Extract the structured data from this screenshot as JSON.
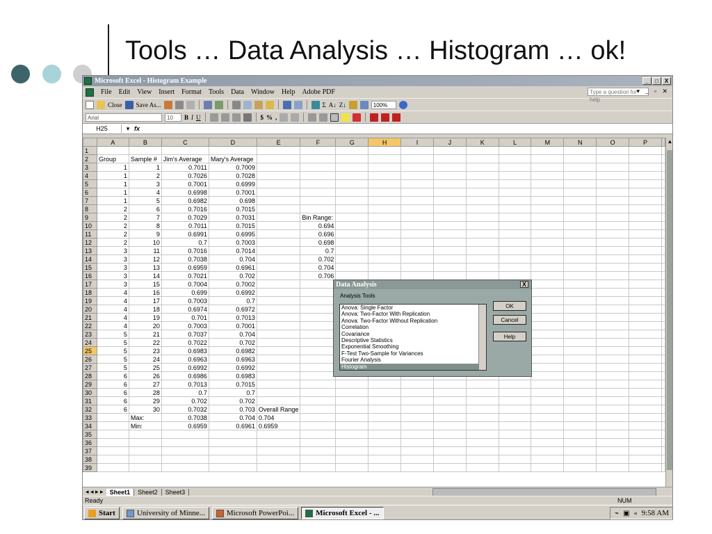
{
  "slide": {
    "title": "Tools … Data Analysis … Histogram … ok!"
  },
  "window": {
    "title": "Microsoft Excel - Histogram Example",
    "controls": [
      "_",
      "□",
      "X"
    ]
  },
  "menu": {
    "items": [
      "File",
      "Edit",
      "View",
      "Insert",
      "Format",
      "Tools",
      "Data",
      "Window",
      "Help",
      "Adobe PDF"
    ],
    "help_placeholder": "Type a question for help"
  },
  "toolbar": {
    "close_label": "Close",
    "saveas_label": "Save As...",
    "zoom": "100%",
    "font": "Arial",
    "font_size": "10",
    "bold": "B",
    "italic": "I",
    "underline": "U",
    "currency": "$",
    "percent": "%",
    "comma": ","
  },
  "formula_bar": {
    "name_box": "H25",
    "fx": "fx"
  },
  "grid": {
    "columns": [
      "A",
      "B",
      "C",
      "D",
      "E",
      "F",
      "G",
      "H",
      "I",
      "J",
      "K",
      "L",
      "M",
      "N",
      "O",
      "P"
    ],
    "selected_column": "H",
    "selected_row": 25,
    "rows": [
      [
        "",
        "",
        "",
        "",
        "",
        ""
      ],
      [
        "Group",
        "Sample #",
        "Jim's Average",
        "Mary's Average",
        "",
        ""
      ],
      [
        "1",
        "1",
        "0.7011",
        "0.7009",
        "",
        ""
      ],
      [
        "1",
        "2",
        "0.7026",
        "0.7028",
        "",
        ""
      ],
      [
        "1",
        "3",
        "0.7001",
        "0.6999",
        "",
        ""
      ],
      [
        "1",
        "4",
        "0.6998",
        "0.7001",
        "",
        ""
      ],
      [
        "1",
        "5",
        "0.6982",
        "0.698",
        "",
        ""
      ],
      [
        "2",
        "6",
        "0.7016",
        "0.7015",
        "",
        ""
      ],
      [
        "2",
        "7",
        "0.7029",
        "0.7031",
        "",
        "Bin Range:"
      ],
      [
        "2",
        "8",
        "0.7011",
        "0.7015",
        "",
        "0.694"
      ],
      [
        "2",
        "9",
        "0.6991",
        "0.6995",
        "",
        "0.696"
      ],
      [
        "2",
        "10",
        "0.7",
        "0.7003",
        "",
        "0.698"
      ],
      [
        "3",
        "11",
        "0.7016",
        "0.7014",
        "",
        "0.7"
      ],
      [
        "3",
        "12",
        "0.7038",
        "0.704",
        "",
        "0.702"
      ],
      [
        "3",
        "13",
        "0.6959",
        "0.6961",
        "",
        "0.704"
      ],
      [
        "3",
        "14",
        "0.7021",
        "0.702",
        "",
        "0.706"
      ],
      [
        "3",
        "15",
        "0.7004",
        "0.7002",
        "",
        ""
      ],
      [
        "4",
        "16",
        "0.699",
        "0.6992",
        "",
        ""
      ],
      [
        "4",
        "17",
        "0.7003",
        "0.7",
        "",
        ""
      ],
      [
        "4",
        "18",
        "0.6974",
        "0.6972",
        "",
        ""
      ],
      [
        "4",
        "19",
        "0.701",
        "0.7013",
        "",
        ""
      ],
      [
        "4",
        "20",
        "0.7003",
        "0.7001",
        "",
        ""
      ],
      [
        "5",
        "21",
        "0.7037",
        "0.704",
        "",
        ""
      ],
      [
        "5",
        "22",
        "0.7022",
        "0.702",
        "",
        ""
      ],
      [
        "5",
        "23",
        "0.6983",
        "0.6982",
        "",
        ""
      ],
      [
        "5",
        "24",
        "0.6963",
        "0.6963",
        "",
        ""
      ],
      [
        "5",
        "25",
        "0.6992",
        "0.6992",
        "",
        ""
      ],
      [
        "6",
        "26",
        "0.6986",
        "0.6983",
        "",
        ""
      ],
      [
        "6",
        "27",
        "0.7013",
        "0.7015",
        "",
        ""
      ],
      [
        "6",
        "28",
        "0.7",
        "0.7",
        "",
        ""
      ],
      [
        "6",
        "29",
        "0.702",
        "0.702",
        "",
        ""
      ],
      [
        "6",
        "30",
        "0.7032",
        "0.703",
        "Overall Range",
        ""
      ],
      [
        "",
        "Max:",
        "0.7038",
        "0.704",
        "0.704",
        ""
      ],
      [
        "",
        "Min:",
        "0.6959",
        "0.6961",
        "0.6959",
        ""
      ],
      [
        "",
        "",
        "",
        "",
        "",
        ""
      ],
      [
        "",
        "",
        "",
        "",
        "",
        ""
      ],
      [
        "",
        "",
        "",
        "",
        "",
        ""
      ],
      [
        "",
        "",
        "",
        "",
        "",
        ""
      ],
      [
        "",
        "",
        "",
        "",
        "",
        ""
      ]
    ]
  },
  "sheet_tabs": [
    "Sheet1",
    "Sheet2",
    "Sheet3"
  ],
  "status": {
    "text": "Ready",
    "num": "NUM"
  },
  "dialog": {
    "title": "Data Analysis",
    "label": "Analysis Tools",
    "items": [
      "Anova: Single Factor",
      "Anova: Two-Factor With Replication",
      "Anova: Two-Factor Without Replication",
      "Correlation",
      "Covariance",
      "Descriptive Statistics",
      "Exponential Smoothing",
      "F-Test Two-Sample for Variances",
      "Fourier Analysis",
      "Histogram"
    ],
    "selected": "Histogram",
    "ok": "OK",
    "cancel": "Cancel",
    "help": "Help",
    "close": "X"
  },
  "taskbar": {
    "start": "Start",
    "tasks": [
      "University of Minne...",
      "Microsoft PowerPoi...",
      "Microsoft Excel - ..."
    ],
    "time": "9:58 AM"
  },
  "colors": {
    "accent_dark": "#3d6468",
    "accent_light": "#a8d3d8",
    "dot_gray": "#cfcfcf"
  }
}
